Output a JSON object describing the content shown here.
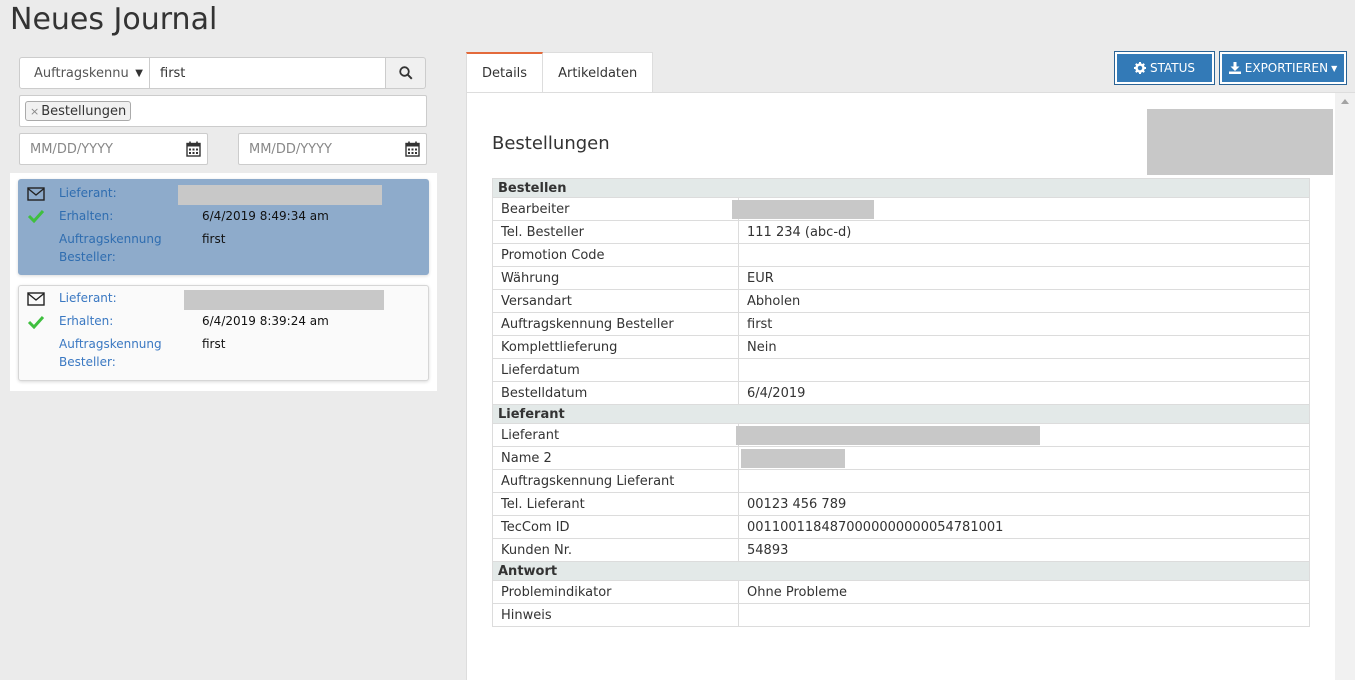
{
  "page_title": "Neues Journal",
  "search": {
    "field_select": "Auftragskennu",
    "query": "first",
    "tag": "Bestellungen",
    "date_from_placeholder": "MM/DD/YYYY",
    "date_to_placeholder": "MM/DD/YYYY"
  },
  "results": [
    {
      "lieferant_label": "Lieferant:",
      "erhalten_label": "Erhalten:",
      "erhalten_value": "6/4/2019 8:49:34 am",
      "auftrag_label_1": "Auftragskennung",
      "auftrag_label_2": "Besteller:",
      "auftrag_value": "first",
      "selected": true
    },
    {
      "lieferant_label": "Lieferant:",
      "erhalten_label": "Erhalten:",
      "erhalten_value": "6/4/2019 8:39:24 am",
      "auftrag_label_1": "Auftragskennung",
      "auftrag_label_2": "Besteller:",
      "auftrag_value": "first",
      "selected": false
    }
  ],
  "tabs": [
    {
      "label": "Details",
      "active": true
    },
    {
      "label": "Artikeldaten",
      "active": false
    }
  ],
  "buttons": {
    "status": "STATUS",
    "export": "EXPORTIEREN"
  },
  "panel_title": "Bestellungen",
  "sections": {
    "bestellen": {
      "header": "Bestellen",
      "rows": [
        {
          "label": "Bearbeiter",
          "value": ""
        },
        {
          "label": "Tel. Besteller",
          "value": "111 234 (abc-d)"
        },
        {
          "label": "Promotion Code",
          "value": ""
        },
        {
          "label": "Währung",
          "value": "EUR"
        },
        {
          "label": "Versandart",
          "value": "Abholen"
        },
        {
          "label": "Auftragskennung Besteller",
          "value": "first"
        },
        {
          "label": "Komplettlieferung",
          "value": "Nein"
        },
        {
          "label": "Lieferdatum",
          "value": ""
        },
        {
          "label": "Bestelldatum",
          "value": "6/4/2019"
        }
      ]
    },
    "lieferant": {
      "header": "Lieferant",
      "rows": [
        {
          "label": "Lieferant",
          "value": ""
        },
        {
          "label": "Name 2",
          "value": ""
        },
        {
          "label": "Auftragskennung Lieferant",
          "value": ""
        },
        {
          "label": "Tel. Lieferant",
          "value": "00123 456 789"
        },
        {
          "label": "TecCom ID",
          "value": "0011001184870000000000054781001"
        },
        {
          "label": "Kunden Nr.",
          "value": "54893"
        }
      ]
    },
    "antwort": {
      "header": "Antwort",
      "rows": [
        {
          "label": "Problemindikator",
          "value": "Ohne Probleme"
        },
        {
          "label": "Hinweis",
          "value": ""
        }
      ]
    }
  },
  "colors": {
    "accent_blue": "#337ab7",
    "selected_card": "#8eabcb",
    "link_blue": "#3a78c2",
    "tab_active_border": "#e36a3b",
    "check_green": "#3fbf3f"
  }
}
